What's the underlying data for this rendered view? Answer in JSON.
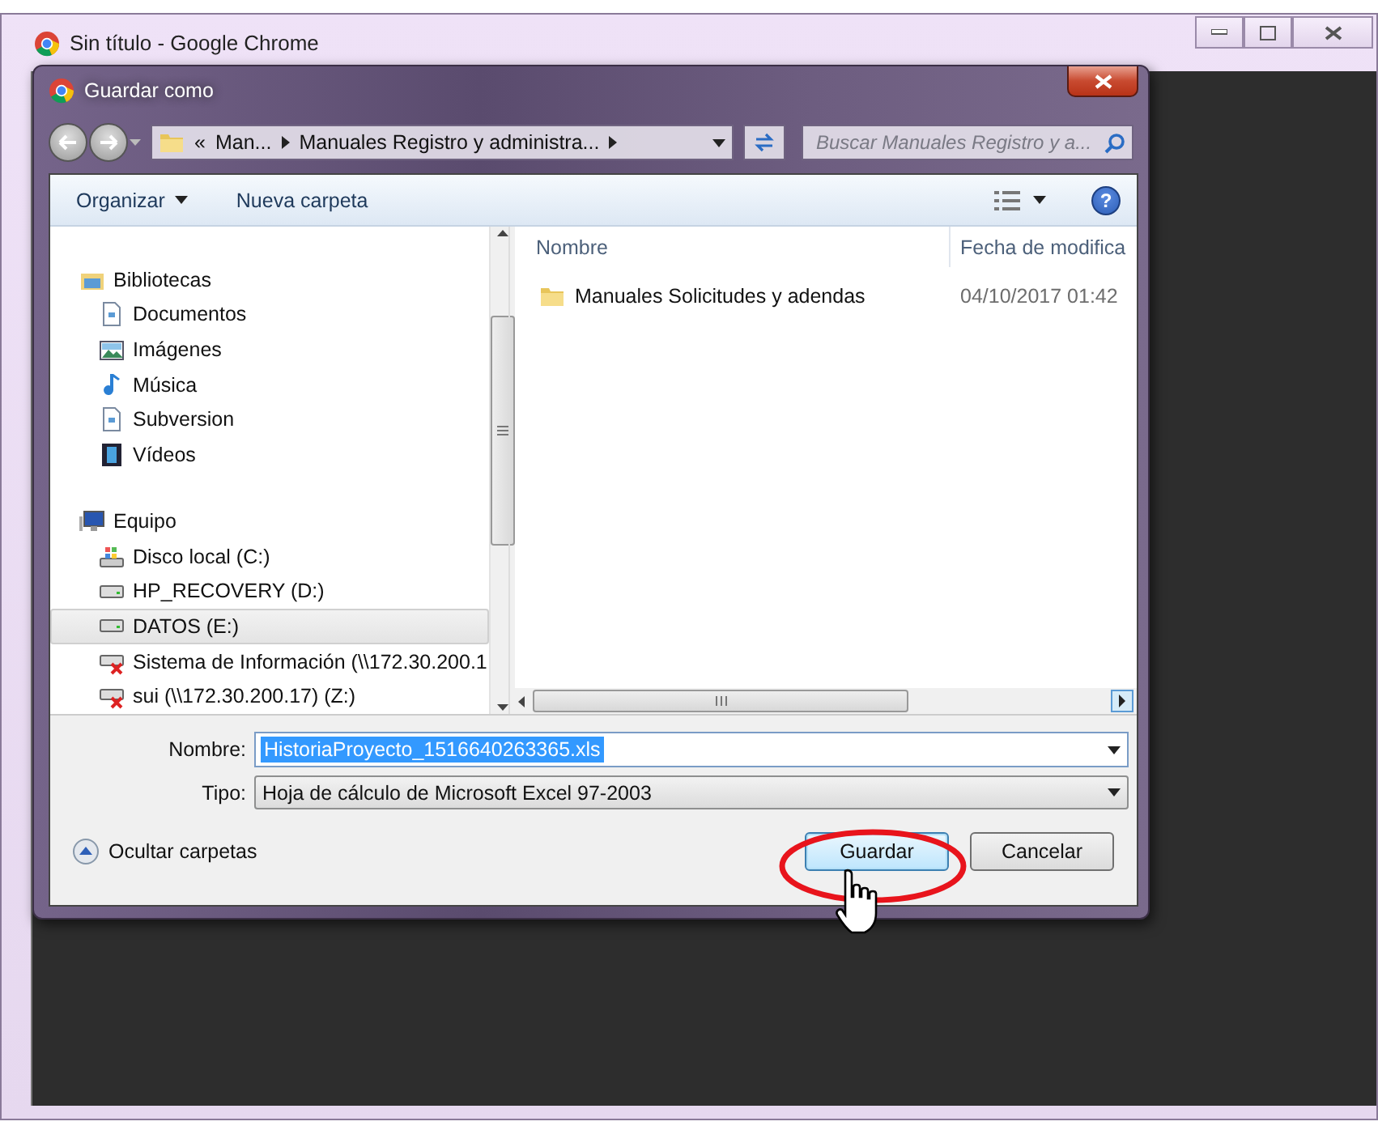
{
  "browser_window": {
    "title": "Sin título - Google Chrome"
  },
  "dialog": {
    "title": "Guardar como",
    "breadcrumb": [
      "«",
      "Man...",
      "Manuales Registro y administra..."
    ],
    "search": {
      "placeholder": "Buscar Manuales Registro y a..."
    },
    "toolbar": [
      "Organizar",
      "Nueva carpeta"
    ],
    "help": "?",
    "nav_tree": [
      {
        "label": "Bibliotecas",
        "kind": "library",
        "selected": false,
        "children": [
          {
            "label": "Documentos",
            "kind": "document",
            "selected": false
          },
          {
            "label": "Imágenes",
            "kind": "image",
            "selected": false
          },
          {
            "label": "Música",
            "kind": "music",
            "selected": false
          },
          {
            "label": "Subversion",
            "kind": "document",
            "selected": false
          },
          {
            "label": "Vídeos",
            "kind": "film",
            "selected": false
          }
        ]
      },
      {
        "label": "Equipo",
        "kind": "computer",
        "selected": false,
        "children": [
          {
            "label": "Disco local (C:)",
            "kind": "system-drive",
            "selected": false
          },
          {
            "label": "HP_RECOVERY (D:)",
            "kind": "drive",
            "selected": false
          },
          {
            "label": "DATOS (E:)",
            "kind": "drive",
            "selected": true
          },
          {
            "label": "Sistema de Información (\\\\172.30.200.1",
            "kind": "network-off",
            "selected": false
          },
          {
            "label": "sui (\\\\172.30.200.17) (Z:)",
            "kind": "network-off",
            "selected": false
          }
        ]
      }
    ],
    "columns": [
      "Nombre",
      "Fecha de modifica"
    ],
    "files": [
      {
        "name": "Manuales Solicitudes y adendas",
        "date": "04/10/2017 01:42"
      }
    ],
    "filename": {
      "label": "Nombre:",
      "value": "HistoriaProyecto_1516640263365.xls"
    },
    "filetype": {
      "label": "Tipo:",
      "value": "Hoja de cálculo de Microsoft Excel 97-2003"
    },
    "hide_folders": "Ocultar carpetas",
    "buttons": [
      {
        "label": "Guardar",
        "kind": "primary"
      },
      {
        "label": "Cancelar",
        "kind": "normal"
      }
    ]
  }
}
